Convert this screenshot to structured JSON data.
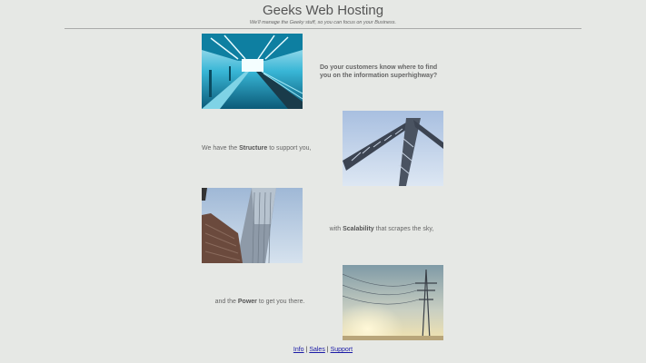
{
  "header": {
    "title": "Geeks Web Hosting",
    "tagline": "We'll manage the Geeky stuff, so you can focus on your Business."
  },
  "sections": [
    {
      "caption": "Do your customers know where to find you on the information superhighway?"
    },
    {
      "caption_pre": "We have the ",
      "caption_bold": "Structure",
      "caption_post": " to support you,"
    },
    {
      "caption_pre": "with ",
      "caption_bold": "Scalability",
      "caption_post": " that scrapes the sky,"
    },
    {
      "caption_pre": "and the ",
      "caption_bold": "Power",
      "caption_post": " to get you there."
    }
  ],
  "footer": {
    "links": [
      "Info",
      "Sales",
      "Support"
    ],
    "separator": "|"
  }
}
